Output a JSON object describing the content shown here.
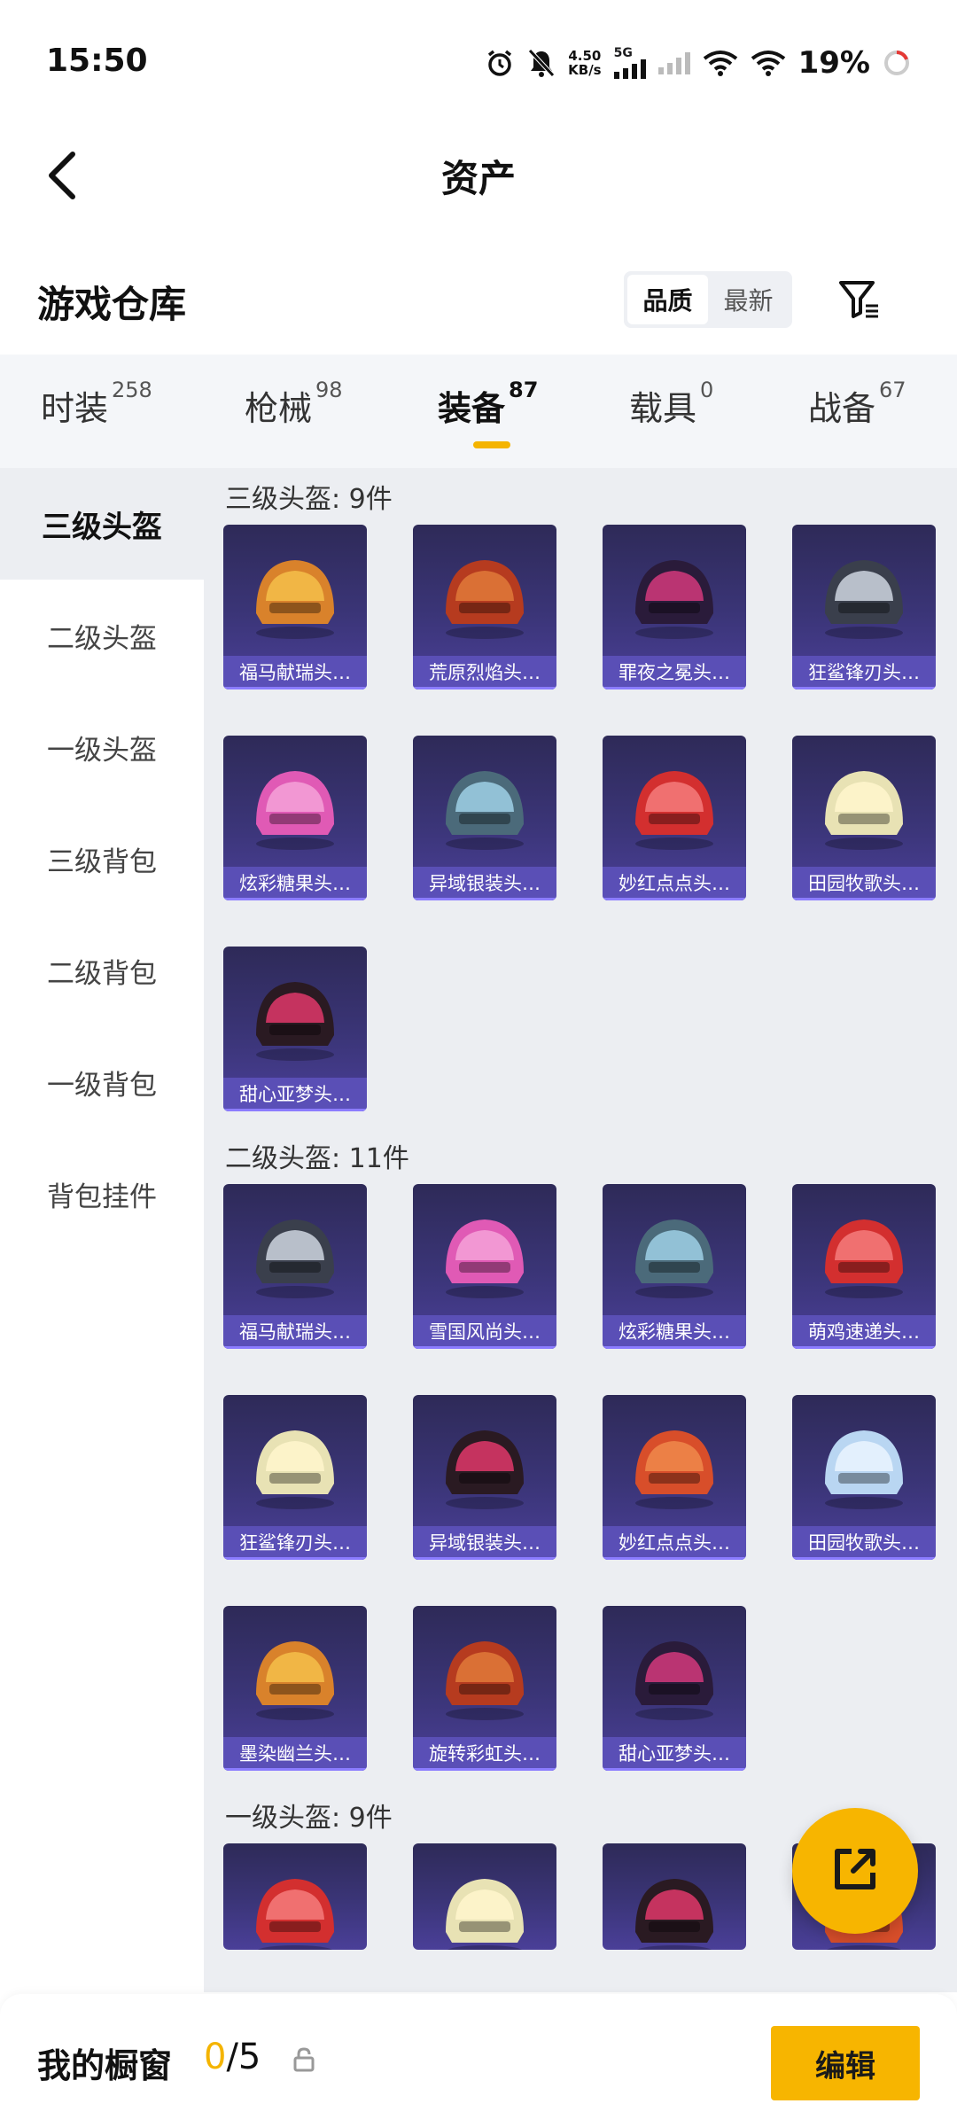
{
  "status_bar": {
    "time": "15:50",
    "net_speed_value": "4.50",
    "net_speed_unit": "KB/s",
    "network_type": "5G",
    "battery": "19%"
  },
  "header": {
    "title": "资产"
  },
  "warehouse": {
    "title": "游戏仓库",
    "sort_options": [
      "品质",
      "最新"
    ],
    "sort_selected": "品质"
  },
  "tabs": [
    {
      "label": "时装",
      "count": "258"
    },
    {
      "label": "枪械",
      "count": "98"
    },
    {
      "label": "装备",
      "count": "87"
    },
    {
      "label": "载具",
      "count": "0"
    },
    {
      "label": "战备",
      "count": "67"
    }
  ],
  "active_tab": "装备",
  "sidebar": {
    "items": [
      "三级头盔",
      "二级头盔",
      "一级头盔",
      "三级背包",
      "二级背包",
      "一级背包",
      "背包挂件"
    ],
    "selected": "三级头盔"
  },
  "sections": [
    {
      "title": "三级头盔: 9件",
      "items": [
        "福马献瑞头…",
        "荒原烈焰头…",
        "罪夜之冕头…",
        "狂鲨锋刃头…",
        "炫彩糖果头…",
        "异域银装头…",
        "妙红点点头…",
        "田园牧歌头…",
        "甜心亚梦头…"
      ]
    },
    {
      "title": "二级头盔: 11件",
      "items": [
        "福马献瑞头…",
        "雪国风尚头…",
        "炫彩糖果头…",
        "萌鸡速递头…",
        "狂鲨锋刃头…",
        "异域银装头…",
        "妙红点点头…",
        "田园牧歌头…",
        "墨染幽兰头…",
        "旋转彩虹头…",
        "甜心亚梦头…"
      ]
    },
    {
      "title": "一级头盔: 9件",
      "items": [
        "",
        "",
        "",
        ""
      ]
    }
  ],
  "bottom_bar": {
    "label": "我的橱窗",
    "count_current": "0",
    "count_total": "/5",
    "edit_label": "编辑"
  },
  "colors": {
    "accent": "#f4b400",
    "card_bg": "#3b3578",
    "card_label_bg": "#5c50b8"
  }
}
